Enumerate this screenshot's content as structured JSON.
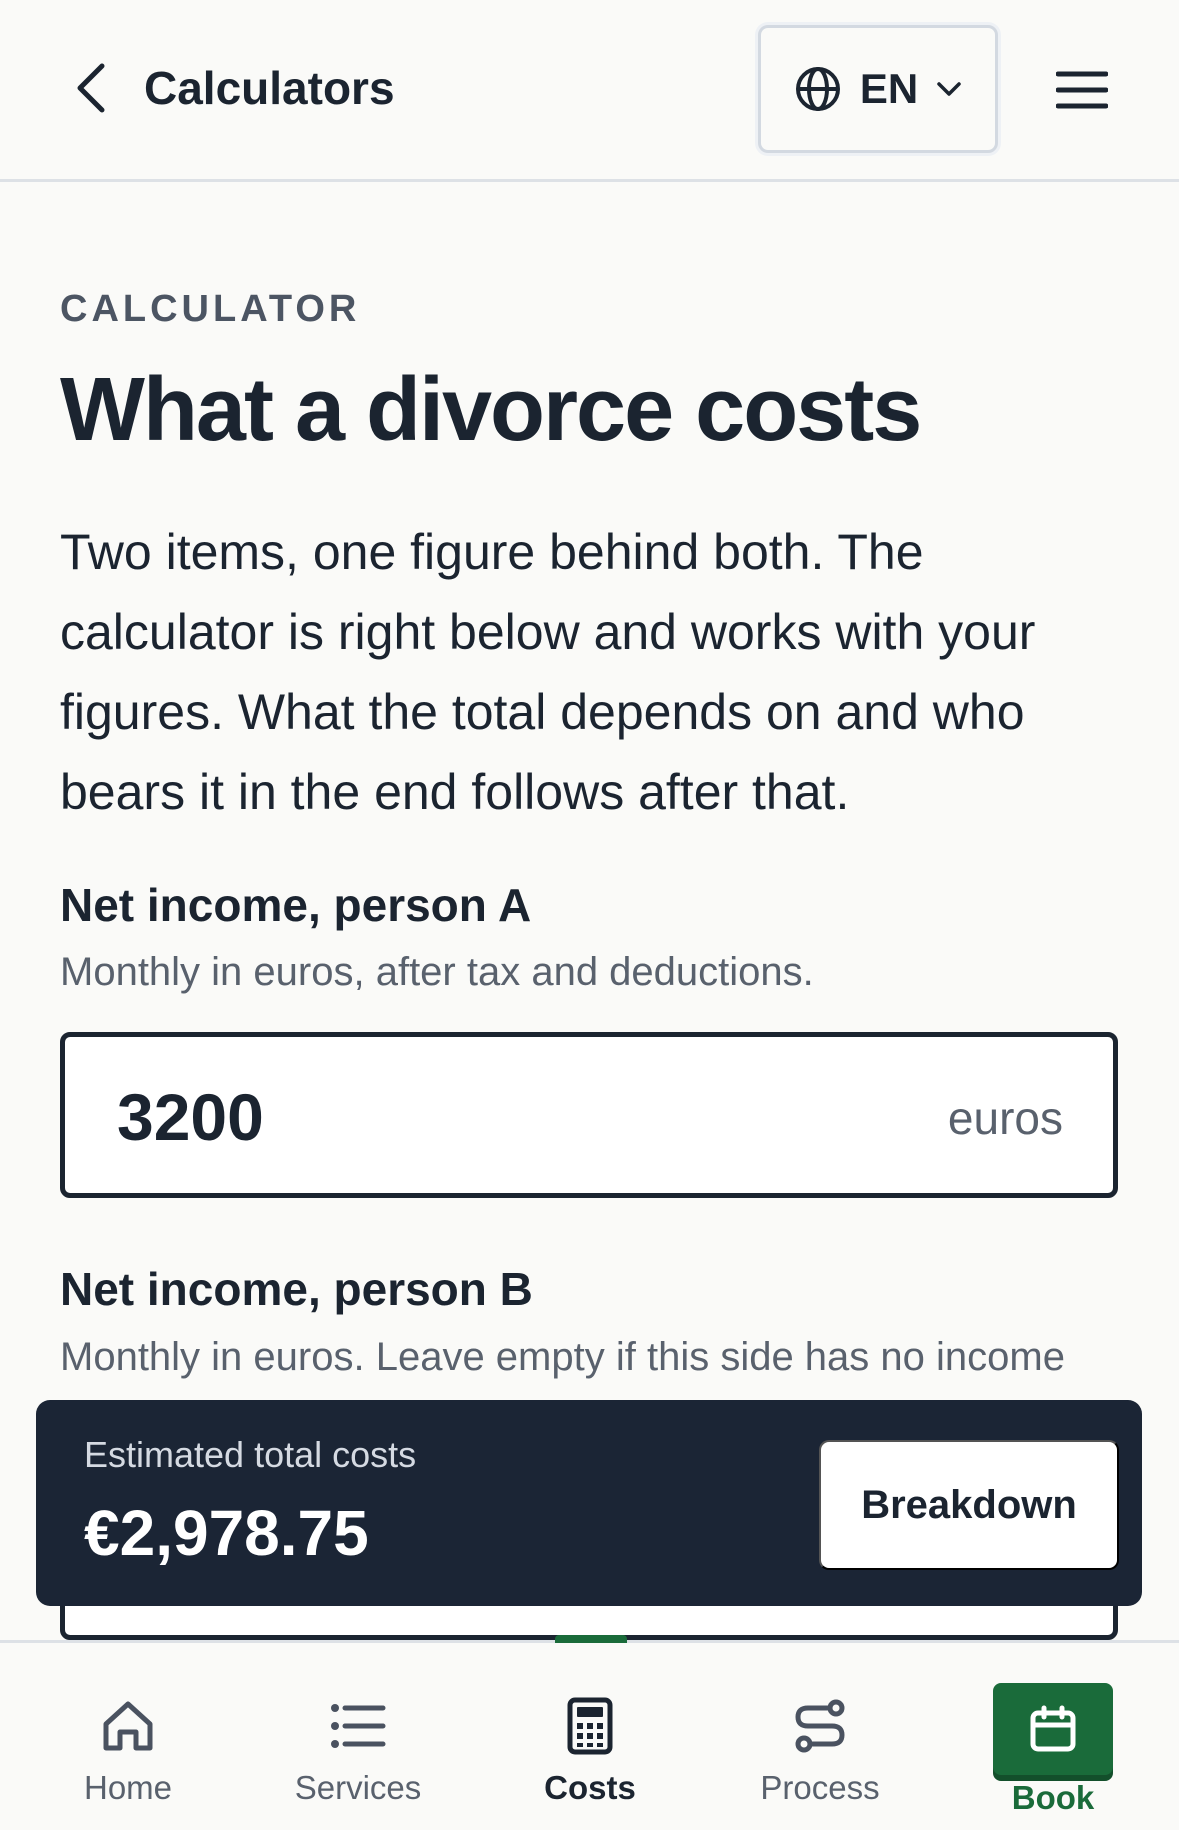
{
  "header": {
    "back_icon": "chevron-left-icon",
    "title": "Calculators",
    "language": "EN",
    "language_icon": "globe-icon",
    "menu_icon": "hamburger-menu-icon"
  },
  "content": {
    "eyebrow": "CALCULATOR",
    "headline": "What a divorce costs",
    "intro": "Two items, one figure behind both. The calculator is right below and works with your figures. What the total depends on and who bears it in the end follows after that.",
    "person_a": {
      "label": "Net income, person A",
      "help": "Monthly in euros, after tax and deductions.",
      "value": "3200",
      "unit": "euros"
    },
    "person_b": {
      "label": "Net income, person B",
      "help": "Monthly in euros. Leave empty if this side has no income"
    }
  },
  "total_bar": {
    "label": "Estimated total costs",
    "value": "€2,978.75",
    "button_label": "Breakdown"
  },
  "bottom_nav": {
    "items": [
      {
        "label": "Home",
        "icon": "home-icon"
      },
      {
        "label": "Services",
        "icon": "list-icon"
      },
      {
        "label": "Costs",
        "icon": "calculator-icon",
        "active": true
      },
      {
        "label": "Process",
        "icon": "route-icon"
      },
      {
        "label": "Book",
        "icon": "calendar-icon"
      }
    ]
  },
  "colors": {
    "primary_dark": "#1b2535",
    "accent_green": "#1a6b3a",
    "background": "#fafaf8",
    "muted_text": "#59616d"
  }
}
